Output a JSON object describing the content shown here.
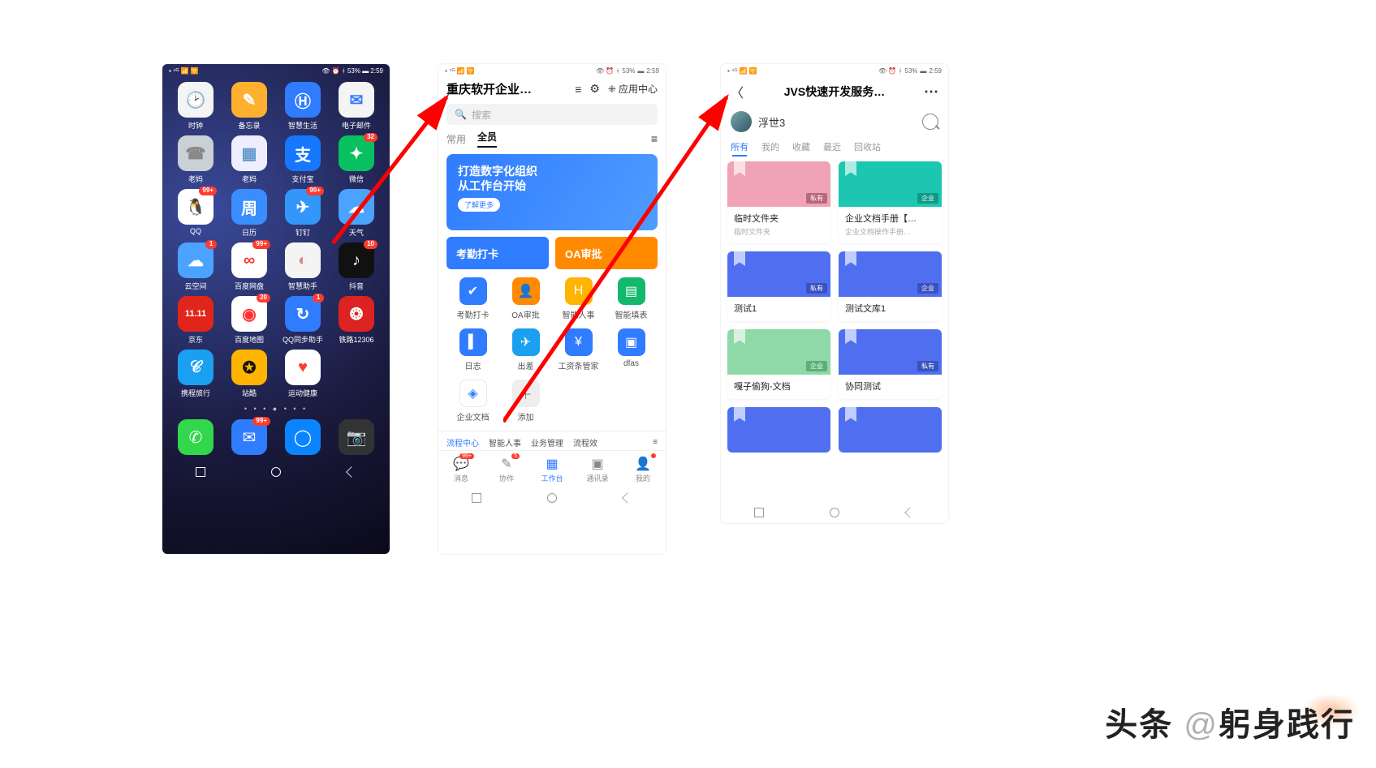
{
  "status": {
    "battery": "53%",
    "time": "2:59"
  },
  "phone1": {
    "apps": [
      {
        "n": "时钟",
        "c": "#f4f4f4",
        "fg": "#c77",
        "g": "🕑",
        "b": null
      },
      {
        "n": "备忘录",
        "c": "#ffb02e",
        "fg": "#fff",
        "g": "✎",
        "b": null
      },
      {
        "n": "智慧生活",
        "c": "#2f7cff",
        "fg": "#fff",
        "g": "Ⓗ",
        "b": null
      },
      {
        "n": "电子邮件",
        "c": "#f4f4f4",
        "fg": "#2f7cff",
        "g": "✉",
        "b": null
      },
      {
        "n": "老妈",
        "c": "#c9d0d6",
        "fg": "#888",
        "g": "☎",
        "b": null
      },
      {
        "n": "老妈",
        "c": "#eef",
        "fg": "#69c",
        "g": "▦",
        "b": null
      },
      {
        "n": "支付宝",
        "c": "#1677ff",
        "fg": "#fff",
        "g": "支",
        "b": null
      },
      {
        "n": "微信",
        "c": "#07c160",
        "fg": "#fff",
        "g": "✦",
        "b": "32"
      },
      {
        "n": "QQ",
        "c": "#fff",
        "fg": "#111",
        "g": "🐧",
        "b": "99+"
      },
      {
        "n": "日历",
        "c": "#3a8dff",
        "fg": "#fff",
        "g": "周",
        "b": null
      },
      {
        "n": "钉钉",
        "c": "#3296fa",
        "fg": "#fff",
        "g": "✈",
        "b": "99+"
      },
      {
        "n": "天气",
        "c": "#4aa3ff",
        "fg": "#fff",
        "g": "☁",
        "b": null
      },
      {
        "n": "云空间",
        "c": "#4aa3ff",
        "fg": "#fff",
        "g": "☁",
        "b": "1"
      },
      {
        "n": "百度网盘",
        "c": "#fff",
        "fg": "#f33",
        "g": "∞",
        "b": "99+"
      },
      {
        "n": "智慧助手",
        "c": "#f4f4f4",
        "fg": "#d88",
        "g": "◐",
        "b": null
      },
      {
        "n": "抖音",
        "c": "#111",
        "fg": "#fff",
        "g": "♪",
        "b": "10"
      },
      {
        "n": "京东",
        "c": "#e1251b",
        "fg": "#fff",
        "g": "11.11",
        "b": null
      },
      {
        "n": "百度地图",
        "c": "#fff",
        "fg": "#f33",
        "g": "◉",
        "b": "20"
      },
      {
        "n": "QQ同步助手",
        "c": "#2f7cff",
        "fg": "#fff",
        "g": "↻",
        "b": "1"
      },
      {
        "n": "铁路12306",
        "c": "#d22",
        "fg": "#fff",
        "g": "❂",
        "b": null
      },
      {
        "n": "携程旅行",
        "c": "#19a0f0",
        "fg": "#fff",
        "g": "𝒞",
        "b": null
      },
      {
        "n": "站酷",
        "c": "#ffb400",
        "fg": "#111",
        "g": "✪",
        "b": null
      },
      {
        "n": "运动健康",
        "c": "#fff",
        "fg": "#ff3b30",
        "g": "♥",
        "b": null
      }
    ],
    "dock": [
      {
        "c": "#32d74b",
        "g": "✆"
      },
      {
        "c": "#2f7cff",
        "g": "✉",
        "b": "99+"
      },
      {
        "c": "#0a84ff",
        "g": "◯"
      },
      {
        "c": "#333",
        "g": "📷"
      }
    ]
  },
  "phone2": {
    "title": "重庆软开企业…",
    "appcenter": "应用中心",
    "search_ph": "搜索",
    "tabs": [
      "常用",
      "全员"
    ],
    "active": 1,
    "banner": {
      "l1": "打造数字化组织",
      "l2": "从工作台开始",
      "btn": "了解更多"
    },
    "tiles": [
      {
        "t": "考勤打卡",
        "c": "#2f7cff"
      },
      {
        "t": "OA审批",
        "c": "#ff8a00"
      }
    ],
    "apps": [
      {
        "n": "考勤打卡",
        "c": "#2f7cff",
        "g": "✔"
      },
      {
        "n": "OA审批",
        "c": "#ff8a00",
        "g": "👤"
      },
      {
        "n": "智能人事",
        "c": "#ffb400",
        "g": "H"
      },
      {
        "n": "智能填表",
        "c": "#14b86d",
        "g": "▤"
      },
      {
        "n": "日志",
        "c": "#2f7cff",
        "g": "▌"
      },
      {
        "n": "出差",
        "c": "#19a0f0",
        "g": "✈"
      },
      {
        "n": "工资条管家",
        "c": "#2f7cff",
        "g": "¥"
      },
      {
        "n": "dfas",
        "c": "#2f7cff",
        "g": "▣"
      },
      {
        "n": "企业文档",
        "c": "#fff",
        "g": "◈",
        "fg": "#2f7cff"
      },
      {
        "n": "添加",
        "c": "#eee",
        "g": "＋",
        "fg": "#888"
      }
    ],
    "bar": [
      "流程中心",
      "智能人事",
      "业务管理",
      "流程效"
    ],
    "bottom": [
      {
        "n": "消息",
        "g": "💬",
        "b": "99+"
      },
      {
        "n": "协作",
        "g": "✎",
        "b": "5"
      },
      {
        "n": "工作台",
        "g": "▦",
        "act": true
      },
      {
        "n": "通讯录",
        "g": "▣"
      },
      {
        "n": "我的",
        "g": "👤",
        "dot": true
      }
    ]
  },
  "phone3": {
    "title": "JVS快速开发服务…",
    "user": "浮世3",
    "filters": [
      "所有",
      "我的",
      "收藏",
      "最近",
      "回收站"
    ],
    "active": 0,
    "cards": [
      {
        "t": "临时文件夹",
        "s": "临时文件夹",
        "c": "#f0a3b5",
        "tag": "私有",
        "tc": "#b8687d"
      },
      {
        "t": "企业文档手册【…",
        "s": "企业文档操作手册…",
        "c": "#1cc6b0",
        "tag": "企业",
        "tc": "#0e9a88"
      },
      {
        "t": "测试1",
        "s": "",
        "c": "#4f6ff0",
        "tag": "私有",
        "tc": "#3a52bd"
      },
      {
        "t": "测试文库1",
        "s": "",
        "c": "#4f6ff0",
        "tag": "企业",
        "tc": "#3a52bd"
      },
      {
        "t": "嘎子偷狗-文档",
        "s": "",
        "c": "#8fd9a8",
        "tag": "企业",
        "tc": "#5fae78"
      },
      {
        "t": "协同测试",
        "s": "",
        "c": "#4f6ff0",
        "tag": "私有",
        "tc": "#3a52bd"
      },
      {
        "t": "",
        "s": "",
        "c": "#4f6ff0",
        "tag": "",
        "tc": ""
      },
      {
        "t": "",
        "s": "",
        "c": "#4f6ff0",
        "tag": "",
        "tc": ""
      }
    ]
  },
  "watermark": {
    "brand": "头条",
    "at": "@",
    "author": "躬身践行"
  }
}
